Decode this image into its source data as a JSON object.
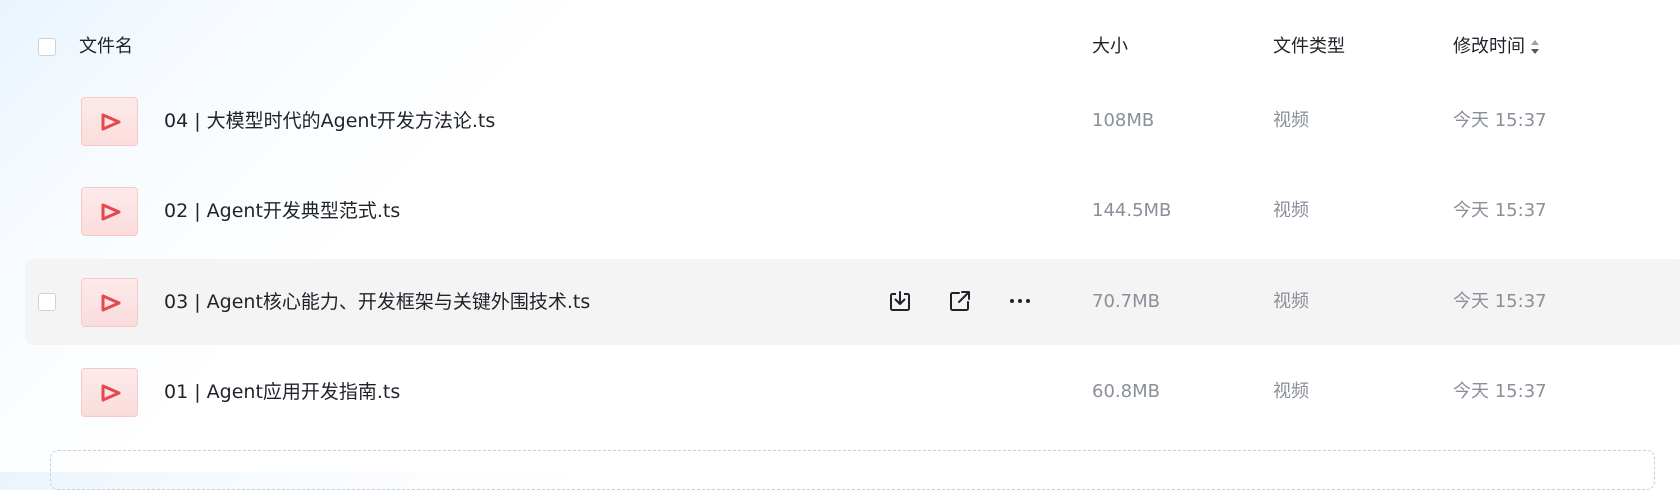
{
  "header": {
    "name_label": "文件名",
    "size_label": "大小",
    "type_label": "文件类型",
    "modified_label": "修改时间"
  },
  "files": [
    {
      "name": "04 | 大模型时代的Agent开发方法论.ts",
      "size": "108MB",
      "type": "视频",
      "modified": "今天 15:37"
    },
    {
      "name": "02 | Agent开发典型范式.ts",
      "size": "144.5MB",
      "type": "视频",
      "modified": "今天 15:37"
    },
    {
      "name": "03 | Agent核心能力、开发框架与关键外围技术.ts",
      "size": "70.7MB",
      "type": "视频",
      "modified": "今天 15:37"
    },
    {
      "name": "01 | Agent应用开发指南.ts",
      "size": "60.8MB",
      "type": "视频",
      "modified": "今天 15:37"
    }
  ],
  "hovered_row_index": 2,
  "icons": {
    "file_thumb": "video-play-icon",
    "download": "download-icon",
    "share": "share-icon",
    "more": "more-icon",
    "sort": "sort-icon"
  },
  "colors": {
    "accent_red": "#e5484d",
    "thumb_bg": "#fbdcdc",
    "hover_row_bg": "#f4f4f5",
    "muted_text": "#8a8f99"
  }
}
